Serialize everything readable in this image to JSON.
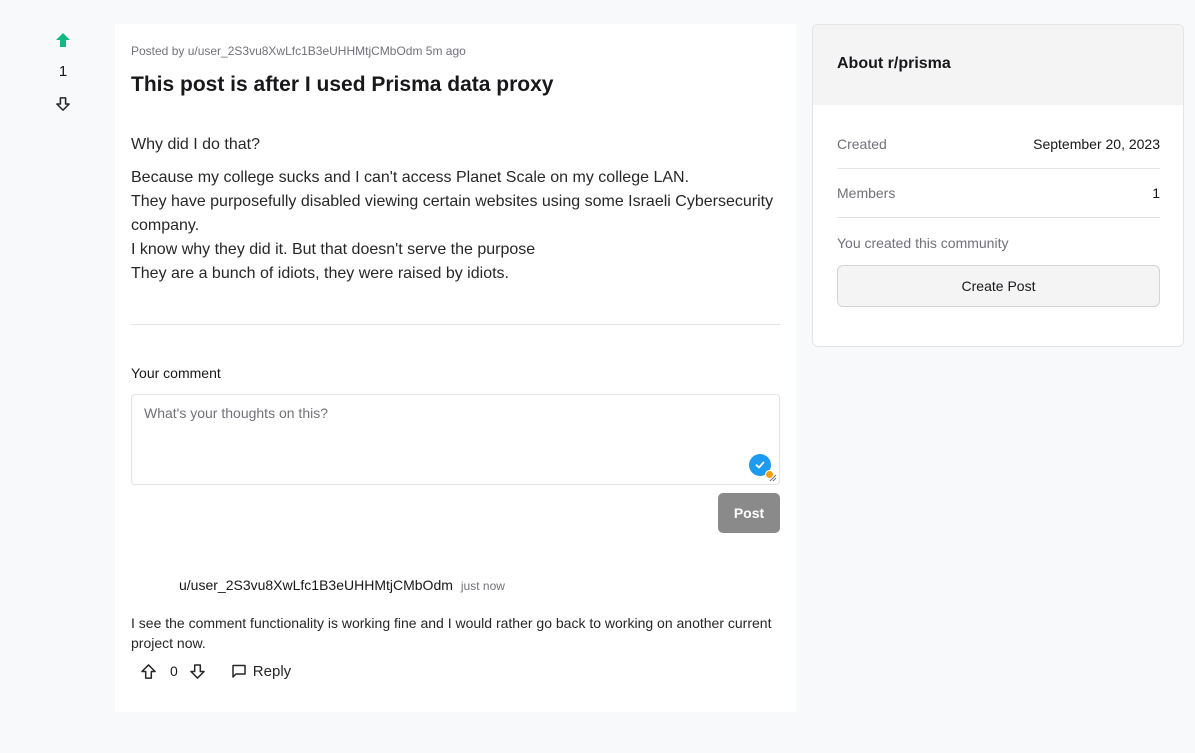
{
  "post": {
    "vote_count": "1",
    "meta": "Posted by u/user_2S3vu8XwLfc1B3eUHHMtjCMbOdm 5m ago",
    "title": "This post is after I used Prisma data proxy",
    "body_line1": "Why did I do that?",
    "body_para2": [
      "Because my college sucks and I can't access Planet Scale on my college LAN.",
      "They have purposefully disabled viewing certain websites using some Israeli Cybersecurity company.",
      "I know why they did it. But that doesn't serve the purpose",
      "They are a bunch of idiots, they were raised by idiots."
    ]
  },
  "comment_form": {
    "label": "Your comment",
    "placeholder": "What's your thoughts on this?",
    "value": "",
    "submit_label": "Post"
  },
  "comments": [
    {
      "author": "u/user_2S3vu8XwLfc1B3eUHHMtjCMbOdm",
      "time": "just now",
      "text": "I see the comment functionality is working fine and I would rather go back to working on another current project now.",
      "votes": "0",
      "reply_label": "Reply"
    }
  ],
  "sidebar": {
    "title": "About r/prisma",
    "created_label": "Created",
    "created_value": "September 20, 2023",
    "members_label": "Members",
    "members_value": "1",
    "note": "You created this community",
    "create_post_label": "Create Post"
  },
  "icons": {
    "upvote_active": "arrow-up-filled-icon",
    "downvote": "arrow-down-outline-icon",
    "upvote": "arrow-up-outline-icon",
    "reply": "message-square-icon",
    "grammar": "check-circle-icon"
  },
  "colors": {
    "upvote_active": "#10b981",
    "post_button": "#8a8a8a",
    "grammar_badge": "#1d9bf0"
  }
}
